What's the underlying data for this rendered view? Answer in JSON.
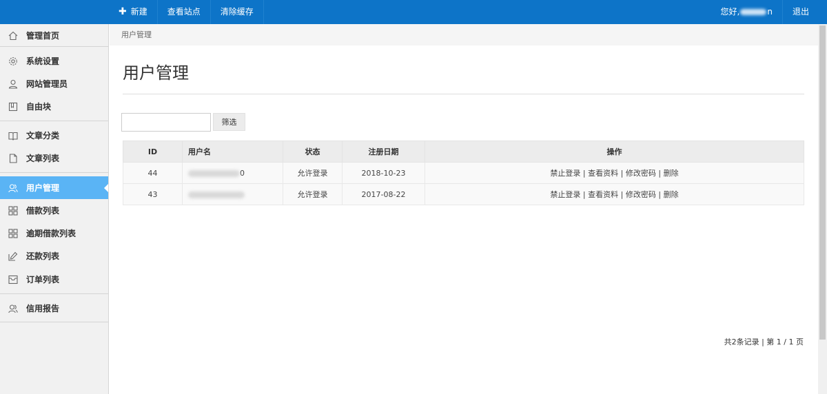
{
  "topbar": {
    "nav": [
      {
        "label": "新建",
        "has_plus": true
      },
      {
        "label": "查看站点"
      },
      {
        "label": "清除缓存"
      }
    ],
    "greeting": "您好,",
    "greeting_suffix": "n",
    "logout": "退出"
  },
  "sidebar": {
    "items": [
      {
        "label": "管理首页",
        "icon": "home-icon"
      },
      {
        "label": "系统设置",
        "icon": "gear-icon"
      },
      {
        "label": "网站管理员",
        "icon": "user-icon"
      },
      {
        "label": "自由块",
        "icon": "block-icon"
      },
      {
        "label": "文章分类",
        "icon": "book-icon"
      },
      {
        "label": "文章列表",
        "icon": "document-icon"
      },
      {
        "label": "用户管理",
        "icon": "users-icon",
        "active": true
      },
      {
        "label": "借款列表",
        "icon": "grid-icon"
      },
      {
        "label": "逾期借款列表",
        "icon": "grid-icon"
      },
      {
        "label": "还款列表",
        "icon": "edit-icon"
      },
      {
        "label": "订单列表",
        "icon": "inbox-icon"
      },
      {
        "label": "信用报告",
        "icon": "users-icon"
      }
    ]
  },
  "breadcrumb": "用户管理",
  "page_title": "用户管理",
  "filter": {
    "button_label": "筛选",
    "value": ""
  },
  "table": {
    "columns": [
      "ID",
      "用户名",
      "状态",
      "注册日期",
      "操作"
    ],
    "rows": [
      {
        "id": "44",
        "username_visible": "0",
        "status": "允许登录",
        "date": "2018-10-23"
      },
      {
        "id": "43",
        "username_visible": "",
        "status": "允许登录",
        "date": "2017-08-22"
      }
    ],
    "actions": [
      "禁止登录",
      "查看资料",
      "修改密码",
      "删除"
    ]
  },
  "pager": "共2条记录 | 第 1 / 1 页",
  "colors": {
    "topbar": "#0d74c8",
    "active": "#5ab4f5",
    "sidebar": "#f1f1f1"
  }
}
